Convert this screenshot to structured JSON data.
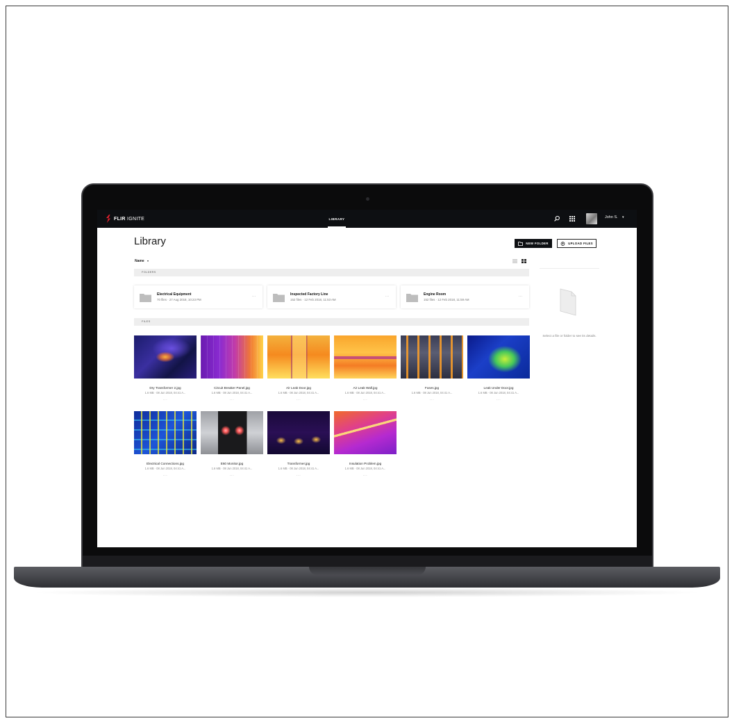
{
  "app": {
    "logo_brand": "FLIR",
    "logo_product": "IGNITE",
    "nav_active": "LIBRARY",
    "user_name": "John S.",
    "accent_color": "#0d0f12",
    "brand_color": "#e2202e"
  },
  "page": {
    "title": "Library",
    "new_folder_label": "NEW FOLDER",
    "upload_label": "UPLOAD FILES",
    "sort_label": "Name"
  },
  "sections": {
    "folders_label": "FOLDERS",
    "files_label": "FILES"
  },
  "folders": [
    {
      "name": "Electrical Equipment",
      "meta": "70 files · 27 Aug 2018, 10:23 PM"
    },
    {
      "name": "Inspected Factory Line",
      "meta": "152 files · 12 Feb 2018, 11:53 AM"
    },
    {
      "name": "Engine Room",
      "meta": "152 files · 12 Feb 2018, 11:59 AM"
    }
  ],
  "files": [
    {
      "name": "Dry Transformer 2.jpg",
      "meta": "1.6 MB · 08 Jun 2018, 04:41 A..."
    },
    {
      "name": "Circuit Breaker Panel.jpg",
      "meta": "1.6 MB · 08 Jun 2018, 04:41 A..."
    },
    {
      "name": "Air Leak Door.jpg",
      "meta": "1.6 MB · 08 Jun 2018, 04:41 A..."
    },
    {
      "name": "Air Leak Wall.jpg",
      "meta": "1.6 MB · 08 Jun 2018, 04:41 A..."
    },
    {
      "name": "Fuses.jpg",
      "meta": "1.6 MB · 08 Jun 2018, 04:41 A..."
    },
    {
      "name": "Leak Under Door.jpg",
      "meta": "1.6 MB · 08 Jun 2018, 04:41 A..."
    },
    {
      "name": "Electrical Connections.jpg",
      "meta": "1.6 MB · 08 Jun 2018, 04:41 A..."
    },
    {
      "name": "E60 Monitor.jpg",
      "meta": "1.6 MB · 08 Jun 2018, 04:41 A..."
    },
    {
      "name": "Transformer.jpg",
      "meta": "1.6 MB · 08 Jun 2018, 04:41 A..."
    },
    {
      "name": "Insulation Problem.jpg",
      "meta": "1.6 MB · 08 Jun 2018, 04:41 A..."
    }
  ],
  "more_glyph": "···",
  "details": {
    "empty_text": "Select a file or folder to see its details."
  }
}
